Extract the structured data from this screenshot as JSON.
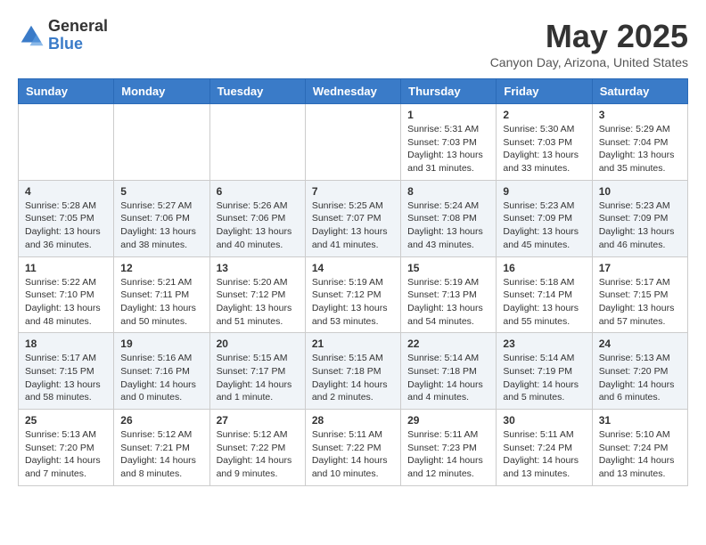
{
  "header": {
    "logo_general": "General",
    "logo_blue": "Blue",
    "month_title": "May 2025",
    "location": "Canyon Day, Arizona, United States"
  },
  "weekdays": [
    "Sunday",
    "Monday",
    "Tuesday",
    "Wednesday",
    "Thursday",
    "Friday",
    "Saturday"
  ],
  "weeks": [
    [
      {
        "day": "",
        "info": ""
      },
      {
        "day": "",
        "info": ""
      },
      {
        "day": "",
        "info": ""
      },
      {
        "day": "",
        "info": ""
      },
      {
        "day": "1",
        "info": "Sunrise: 5:31 AM\nSunset: 7:03 PM\nDaylight: 13 hours\nand 31 minutes."
      },
      {
        "day": "2",
        "info": "Sunrise: 5:30 AM\nSunset: 7:03 PM\nDaylight: 13 hours\nand 33 minutes."
      },
      {
        "day": "3",
        "info": "Sunrise: 5:29 AM\nSunset: 7:04 PM\nDaylight: 13 hours\nand 35 minutes."
      }
    ],
    [
      {
        "day": "4",
        "info": "Sunrise: 5:28 AM\nSunset: 7:05 PM\nDaylight: 13 hours\nand 36 minutes."
      },
      {
        "day": "5",
        "info": "Sunrise: 5:27 AM\nSunset: 7:06 PM\nDaylight: 13 hours\nand 38 minutes."
      },
      {
        "day": "6",
        "info": "Sunrise: 5:26 AM\nSunset: 7:06 PM\nDaylight: 13 hours\nand 40 minutes."
      },
      {
        "day": "7",
        "info": "Sunrise: 5:25 AM\nSunset: 7:07 PM\nDaylight: 13 hours\nand 41 minutes."
      },
      {
        "day": "8",
        "info": "Sunrise: 5:24 AM\nSunset: 7:08 PM\nDaylight: 13 hours\nand 43 minutes."
      },
      {
        "day": "9",
        "info": "Sunrise: 5:23 AM\nSunset: 7:09 PM\nDaylight: 13 hours\nand 45 minutes."
      },
      {
        "day": "10",
        "info": "Sunrise: 5:23 AM\nSunset: 7:09 PM\nDaylight: 13 hours\nand 46 minutes."
      }
    ],
    [
      {
        "day": "11",
        "info": "Sunrise: 5:22 AM\nSunset: 7:10 PM\nDaylight: 13 hours\nand 48 minutes."
      },
      {
        "day": "12",
        "info": "Sunrise: 5:21 AM\nSunset: 7:11 PM\nDaylight: 13 hours\nand 50 minutes."
      },
      {
        "day": "13",
        "info": "Sunrise: 5:20 AM\nSunset: 7:12 PM\nDaylight: 13 hours\nand 51 minutes."
      },
      {
        "day": "14",
        "info": "Sunrise: 5:19 AM\nSunset: 7:12 PM\nDaylight: 13 hours\nand 53 minutes."
      },
      {
        "day": "15",
        "info": "Sunrise: 5:19 AM\nSunset: 7:13 PM\nDaylight: 13 hours\nand 54 minutes."
      },
      {
        "day": "16",
        "info": "Sunrise: 5:18 AM\nSunset: 7:14 PM\nDaylight: 13 hours\nand 55 minutes."
      },
      {
        "day": "17",
        "info": "Sunrise: 5:17 AM\nSunset: 7:15 PM\nDaylight: 13 hours\nand 57 minutes."
      }
    ],
    [
      {
        "day": "18",
        "info": "Sunrise: 5:17 AM\nSunset: 7:15 PM\nDaylight: 13 hours\nand 58 minutes."
      },
      {
        "day": "19",
        "info": "Sunrise: 5:16 AM\nSunset: 7:16 PM\nDaylight: 14 hours\nand 0 minutes."
      },
      {
        "day": "20",
        "info": "Sunrise: 5:15 AM\nSunset: 7:17 PM\nDaylight: 14 hours\nand 1 minute."
      },
      {
        "day": "21",
        "info": "Sunrise: 5:15 AM\nSunset: 7:18 PM\nDaylight: 14 hours\nand 2 minutes."
      },
      {
        "day": "22",
        "info": "Sunrise: 5:14 AM\nSunset: 7:18 PM\nDaylight: 14 hours\nand 4 minutes."
      },
      {
        "day": "23",
        "info": "Sunrise: 5:14 AM\nSunset: 7:19 PM\nDaylight: 14 hours\nand 5 minutes."
      },
      {
        "day": "24",
        "info": "Sunrise: 5:13 AM\nSunset: 7:20 PM\nDaylight: 14 hours\nand 6 minutes."
      }
    ],
    [
      {
        "day": "25",
        "info": "Sunrise: 5:13 AM\nSunset: 7:20 PM\nDaylight: 14 hours\nand 7 minutes."
      },
      {
        "day": "26",
        "info": "Sunrise: 5:12 AM\nSunset: 7:21 PM\nDaylight: 14 hours\nand 8 minutes."
      },
      {
        "day": "27",
        "info": "Sunrise: 5:12 AM\nSunset: 7:22 PM\nDaylight: 14 hours\nand 9 minutes."
      },
      {
        "day": "28",
        "info": "Sunrise: 5:11 AM\nSunset: 7:22 PM\nDaylight: 14 hours\nand 10 minutes."
      },
      {
        "day": "29",
        "info": "Sunrise: 5:11 AM\nSunset: 7:23 PM\nDaylight: 14 hours\nand 12 minutes."
      },
      {
        "day": "30",
        "info": "Sunrise: 5:11 AM\nSunset: 7:24 PM\nDaylight: 14 hours\nand 13 minutes."
      },
      {
        "day": "31",
        "info": "Sunrise: 5:10 AM\nSunset: 7:24 PM\nDaylight: 14 hours\nand 13 minutes."
      }
    ]
  ]
}
